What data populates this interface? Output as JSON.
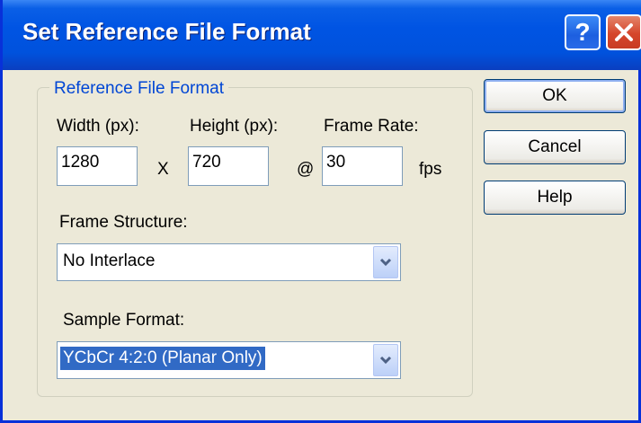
{
  "window": {
    "title": "Set Reference File Format"
  },
  "titlebar": {
    "help_label": "?",
    "close_icon": "close-icon"
  },
  "group": {
    "title": "Reference File Format",
    "width_label": "Width (px):",
    "height_label": "Height (px):",
    "framerate_label": "Frame Rate:",
    "width_value": "1280",
    "height_value": "720",
    "framerate_value": "30",
    "times_symbol": "X",
    "at_symbol": "@",
    "fps_unit": "fps",
    "frame_structure_label": "Frame Structure:",
    "frame_structure_value": "No Interlace",
    "sample_format_label": "Sample Format:",
    "sample_format_value": "YCbCr 4:2:0 (Planar Only)"
  },
  "buttons": {
    "ok": "OK",
    "cancel": "Cancel",
    "help": "Help"
  },
  "colors": {
    "title_bar": "#0054e3",
    "group_title": "#0046d5",
    "selection": "#316ac5",
    "dialog_bg": "#ece9d8"
  }
}
